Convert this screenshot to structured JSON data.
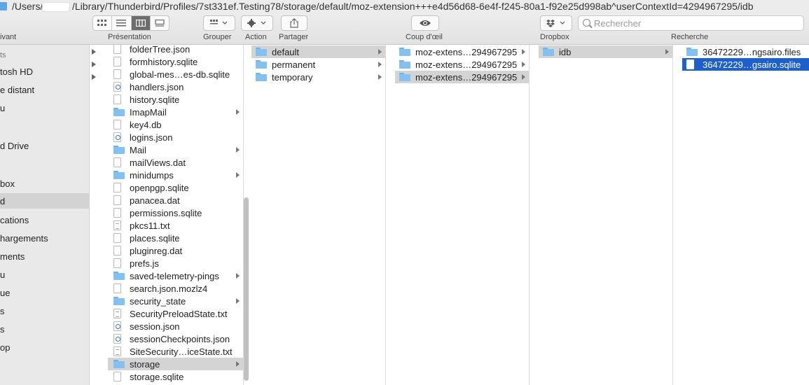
{
  "path_bar": {
    "prefix": "/Users/",
    "rest": "/Library/Thunderbird/Profiles/7st331ef.Testing78/storage/default/moz-extension+++e4d56d68-6e4f-f245-80a1-f92e25d998ab^userContextId=4294967295/idb"
  },
  "toolbar": {
    "back_forward_label": "ivant",
    "view_label": "Présentation",
    "group_label": "Grouper",
    "action_label": "Action",
    "share_label": "Partager",
    "quicklook_label": "Coup d'œil",
    "dropbox_label": "Dropbox",
    "search_label": "Recherche",
    "search_placeholder": "Rechercher"
  },
  "sidebar": {
    "items": [
      {
        "label": "ts",
        "section": true
      },
      {
        "label": "tosh HD"
      },
      {
        "label": "e distant"
      },
      {
        "label": "u"
      },
      {
        "label": "d Drive"
      },
      {
        "label": "box"
      },
      {
        "label": "d",
        "selected": true
      },
      {
        "label": "cations"
      },
      {
        "label": "hargements"
      },
      {
        "label": "ments"
      },
      {
        "label": "u"
      },
      {
        "label": "ue"
      },
      {
        "label": "s"
      },
      {
        "label": "s"
      },
      {
        "label": "op"
      }
    ]
  },
  "columns": {
    "profile": [
      {
        "name": "folderTree.json",
        "icon": "file-icon"
      },
      {
        "name": "formhistory.sqlite",
        "icon": "file-icon"
      },
      {
        "name": "global-mes…es-db.sqlite",
        "icon": "file-icon"
      },
      {
        "name": "handlers.json",
        "icon": "json-file-icon"
      },
      {
        "name": "history.sqlite",
        "icon": "file-icon"
      },
      {
        "name": "ImapMail",
        "icon": "folder-icon",
        "folder": true
      },
      {
        "name": "key4.db",
        "icon": "file-icon"
      },
      {
        "name": "logins.json",
        "icon": "json-file-icon"
      },
      {
        "name": "Mail",
        "icon": "folder-icon",
        "folder": true
      },
      {
        "name": "mailViews.dat",
        "icon": "file-icon"
      },
      {
        "name": "minidumps",
        "icon": "folder-icon",
        "folder": true
      },
      {
        "name": "openpgp.sqlite",
        "icon": "file-icon"
      },
      {
        "name": "panacea.dat",
        "icon": "file-icon"
      },
      {
        "name": "permissions.sqlite",
        "icon": "file-icon"
      },
      {
        "name": "pkcs11.txt",
        "icon": "text-file-icon"
      },
      {
        "name": "places.sqlite",
        "icon": "file-icon"
      },
      {
        "name": "pluginreg.dat",
        "icon": "file-icon"
      },
      {
        "name": "prefs.js",
        "icon": "file-icon"
      },
      {
        "name": "saved-telemetry-pings",
        "icon": "folder-icon",
        "folder": true
      },
      {
        "name": "search.json.mozlz4",
        "icon": "file-icon"
      },
      {
        "name": "security_state",
        "icon": "folder-icon",
        "folder": true
      },
      {
        "name": "SecurityPreloadState.txt",
        "icon": "text-file-icon"
      },
      {
        "name": "session.json",
        "icon": "json-file-icon"
      },
      {
        "name": "sessionCheckpoints.json",
        "icon": "json-file-icon"
      },
      {
        "name": "SiteSecurity…iceState.txt",
        "icon": "text-file-icon"
      },
      {
        "name": "storage",
        "icon": "folder-icon",
        "folder": true,
        "selected": true
      },
      {
        "name": "storage.sqlite",
        "icon": "file-icon"
      }
    ],
    "storage": [
      {
        "name": "default",
        "icon": "folder-icon",
        "folder": true,
        "selected": true
      },
      {
        "name": "permanent",
        "icon": "folder-icon",
        "folder": true
      },
      {
        "name": "temporary",
        "icon": "folder-icon",
        "folder": true
      }
    ],
    "default": [
      {
        "name": "moz-extens…294967295",
        "icon": "folder-icon",
        "folder": true
      },
      {
        "name": "moz-extens…294967295",
        "icon": "folder-icon",
        "folder": true
      },
      {
        "name": "moz-extens…294967295",
        "icon": "folder-icon",
        "folder": true,
        "selected": true
      }
    ],
    "extension": [
      {
        "name": "idb",
        "icon": "folder-icon",
        "folder": true,
        "selected": true
      }
    ],
    "idb": [
      {
        "name": "36472229…ngsairo.files",
        "icon": "folder-icon",
        "folder": true
      },
      {
        "name": "36472229…gsairo.sqlite",
        "icon": "file-icon",
        "active": true
      }
    ]
  },
  "colors": {
    "selection_active": "#1c5fcd",
    "selection_inactive": "#d4d4d4",
    "folder": "#84c1f0"
  }
}
